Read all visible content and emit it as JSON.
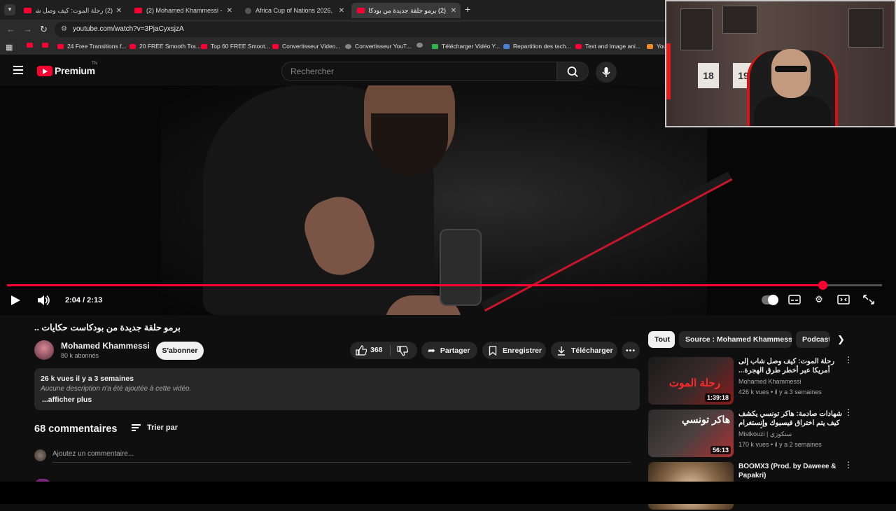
{
  "browser": {
    "tabs": [
      {
        "title": "(2) رحلة الموت: كيف وصل شاب",
        "favicon": "youtube"
      },
      {
        "title": "(2) Mohamed Khammessi - You",
        "favicon": "youtube"
      },
      {
        "title": "Africa Cup of Nations 2026, Fo",
        "favicon": "generic"
      },
      {
        "title": "(2) برمو حلقة جديدة من بودكاست",
        "favicon": "youtube"
      }
    ],
    "url": "youtube.com/watch?v=3PjaCyxsjzA",
    "bookmarks": [
      {
        "label": "",
        "icon": "youtube"
      },
      {
        "label": "",
        "icon": "youtube"
      },
      {
        "label": "24 Free Transitions f...",
        "icon": "youtube"
      },
      {
        "label": "20 FREE Smooth Tra...",
        "icon": "youtube"
      },
      {
        "label": "Top 60 FREE Smoot...",
        "icon": "youtube"
      },
      {
        "label": "Convertisseur Video...",
        "icon": "youtube"
      },
      {
        "label": "Convertisseur YouT...",
        "icon": "generic"
      },
      {
        "label": "",
        "icon": "globe"
      },
      {
        "label": "Télécharger Vidéo Y...",
        "icon": "download"
      },
      {
        "label": "Repartition des tach...",
        "icon": "docs"
      },
      {
        "label": "Text and Image ani...",
        "icon": "youtube"
      },
      {
        "label": "You",
        "icon": "orange"
      }
    ]
  },
  "youtube": {
    "logo_text": "Premium",
    "logo_tn": "TN",
    "search_placeholder": "Rechercher"
  },
  "player": {
    "current_time": "2:04",
    "duration": "2:13",
    "time_display": "2:04 / 2:13",
    "progress_fraction": 0.932,
    "accent": "#ff0033"
  },
  "video": {
    "title": "برمو حلقة جديدة من بودكاست حكايات ..",
    "channel_name": "Mohamed Khammessi",
    "subscribers": "80 k abonnés",
    "subscribe_label": "S'abonner",
    "like_count": "368",
    "share_label": "Partager",
    "save_label": "Enregistrer",
    "download_label": "Télécharger",
    "description_meta": "26 k vues  il y a 3 semaines",
    "description_text": "Aucune description n'a été ajoutée à cette vidéo.",
    "show_more": "...afficher plus"
  },
  "comments": {
    "count_label": "68 commentaires",
    "sort_label": "Trier par",
    "add_placeholder": "Ajoutez un commentaire..."
  },
  "sidebar": {
    "chips": [
      "Tout",
      "Source : Mohamed Khammessi",
      "Podcast"
    ],
    "recommendations": [
      {
        "title": "رحلة الموت: كيف وصل شاب إلى أمريكا عبر أخطر طرق الهجرة... مافيا، عصابات...",
        "channel": "Mohamed Khammessi",
        "meta": "426 k vues  •  il y a 3 semaines",
        "duration": "1:39:18",
        "thumb_text": "رحلة الموت"
      },
      {
        "title": "شهادات صادمة: هاكر تونسي يكشف كيف يتم اختراق فيسبوك وإنستغرام وسرقة الأموال ...",
        "channel": "Mistkouzi | ستكوزي",
        "meta": "170 k vues  •  il y a 2 semaines",
        "duration": "56:13",
        "thumb_text": "هاكر تونسي"
      },
      {
        "title": "BOOMX3 (Prod. by Daweee & Papakri)",
        "channel": "",
        "meta": "",
        "duration": "",
        "thumb_text": ""
      }
    ]
  },
  "webcam": {
    "jersey_left": "18",
    "jersey_right": "19"
  }
}
